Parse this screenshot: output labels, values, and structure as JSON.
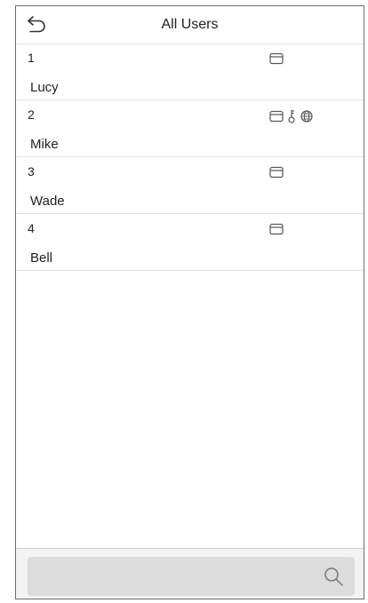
{
  "header": {
    "title": "All Users",
    "back_icon": "back-arrow-icon"
  },
  "users": [
    {
      "id": "1",
      "name": "Lucy",
      "icons": [
        "card-icon"
      ]
    },
    {
      "id": "2",
      "name": "Mike",
      "icons": [
        "card-icon",
        "key-icon",
        "face-icon"
      ]
    },
    {
      "id": "3",
      "name": "Wade",
      "icons": [
        "card-icon"
      ]
    },
    {
      "id": "4",
      "name": "Bell",
      "icons": [
        "card-icon"
      ]
    }
  ],
  "search": {
    "placeholder": "",
    "icon": "search-icon"
  }
}
